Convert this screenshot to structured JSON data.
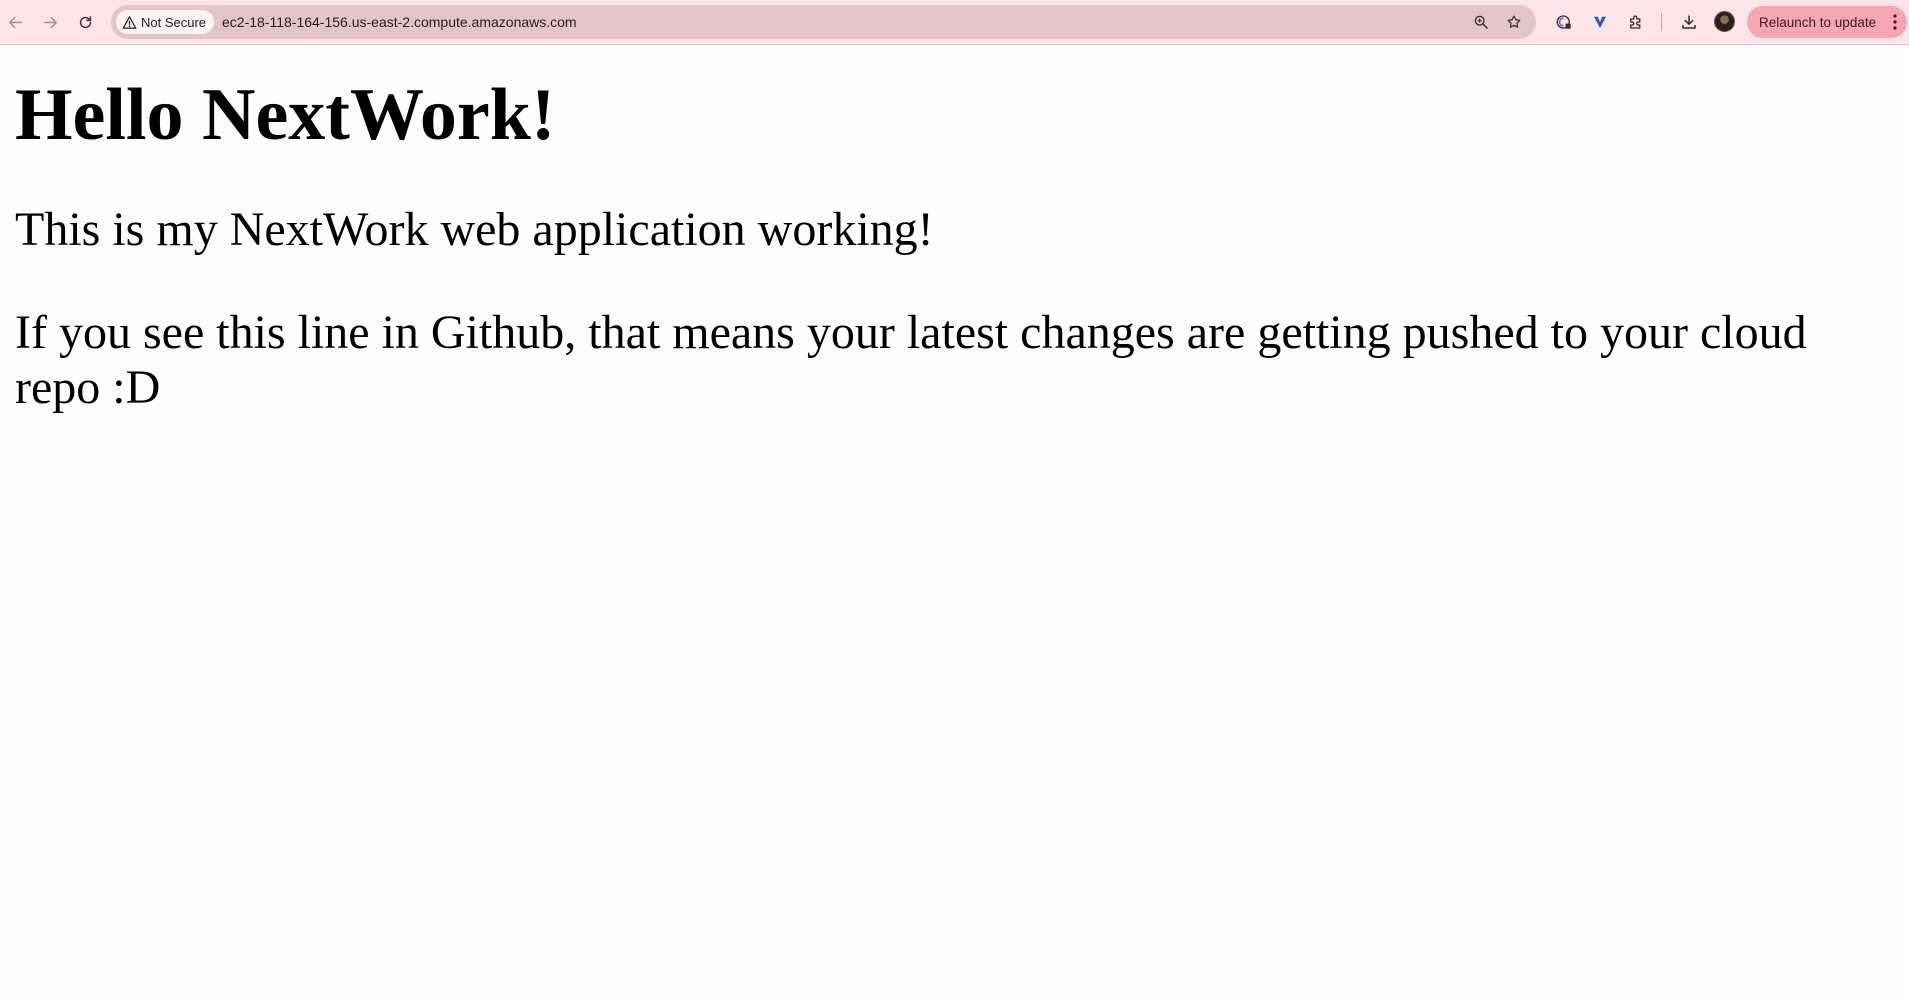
{
  "browser": {
    "security_label": "Not Secure",
    "url": "ec2-18-118-164-156.us-east-2.compute.amazonaws.com",
    "relaunch_label": "Relaunch to update",
    "toolbar_color": "#fde4e8",
    "relaunch_color": "#f6a6b2",
    "icons": {
      "back": "arrow-left-icon",
      "forward": "arrow-right-icon",
      "reload": "reload-icon",
      "security": "warning-triangle-icon",
      "zoom": "zoom-icon",
      "bookmark": "star-icon",
      "extension_1": "shield-extension-icon",
      "extension_2": "v-extension-icon",
      "extensions": "puzzle-icon",
      "downloads": "download-icon",
      "profile": "avatar",
      "menu": "kebab-icon"
    }
  },
  "page": {
    "heading": "Hello NextWork!",
    "paragraphs": [
      "This is my NextWork web application working!",
      "If you see this line in Github, that means your latest changes are getting pushed to your cloud repo :D"
    ]
  }
}
